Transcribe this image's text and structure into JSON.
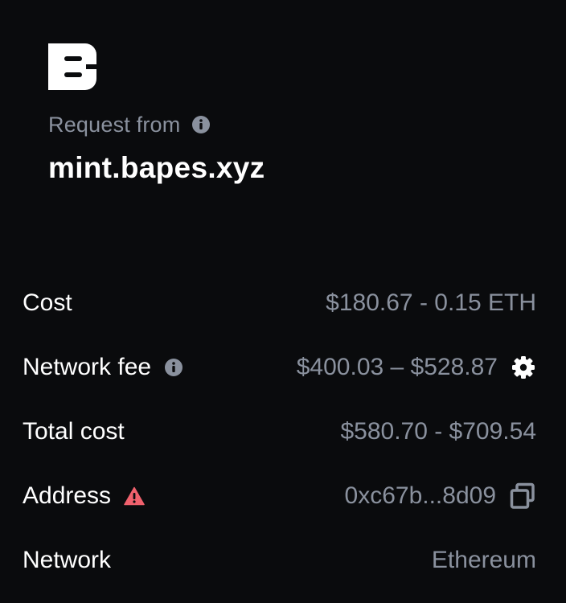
{
  "header": {
    "request_label": "Request from",
    "domain": "mint.bapes.xyz",
    "logo_icon": "brand-b-logo",
    "info_icon": "info-icon"
  },
  "details": {
    "cost": {
      "label": "Cost",
      "value": "$180.67 - 0.15 ETH"
    },
    "network_fee": {
      "label": "Network fee",
      "value": "$400.03 – $528.87",
      "info_icon": "info-icon",
      "action_icon": "gear-icon"
    },
    "total_cost": {
      "label": "Total cost",
      "value": "$580.70 - $709.54"
    },
    "address": {
      "label": "Address",
      "value": "0xc67b...8d09",
      "warning_icon": "warning-icon",
      "action_icon": "copy-icon"
    },
    "network": {
      "label": "Network",
      "value": "Ethereum"
    }
  },
  "colors": {
    "background": "#0a0b0d",
    "primary_text": "#ffffff",
    "secondary_text": "#8a919e",
    "warning": "#f0616d"
  }
}
